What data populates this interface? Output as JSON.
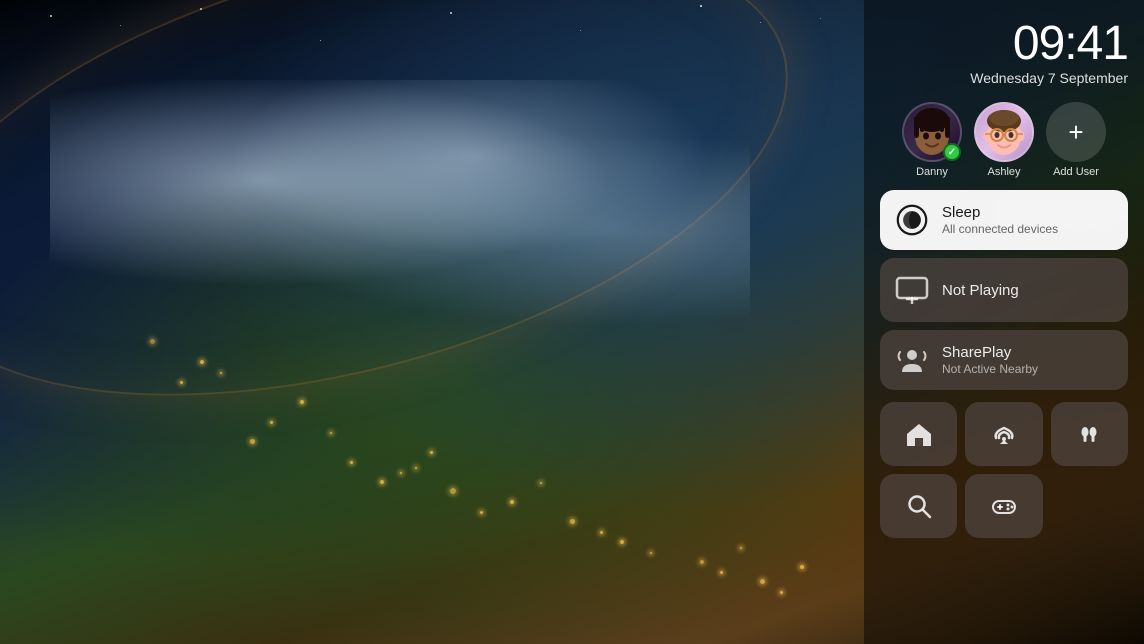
{
  "background": {
    "description": "Earth from space with city lights and clouds"
  },
  "header": {
    "time": "09:41",
    "date": "Wednesday 7 September"
  },
  "users": [
    {
      "name": "Danny",
      "active": true,
      "emoji": "🧑🏿"
    },
    {
      "name": "Ashley",
      "active": false,
      "emoji": "🧑"
    }
  ],
  "add_user": {
    "label": "Add User",
    "symbol": "+"
  },
  "sleep_card": {
    "title": "Sleep",
    "subtitle": "All connected devices"
  },
  "now_playing_card": {
    "title": "Not Playing"
  },
  "shareplay_card": {
    "title": "SharePlay",
    "subtitle": "Not Active Nearby"
  },
  "grid_buttons": [
    {
      "name": "home-icon",
      "label": "Home"
    },
    {
      "name": "airplay-icon",
      "label": "AirPlay"
    },
    {
      "name": "airpods-icon",
      "label": "AirPods"
    }
  ],
  "grid_buttons_bottom": [
    {
      "name": "search-icon",
      "label": "Search"
    },
    {
      "name": "gamecontroller-icon",
      "label": "Game Controller"
    }
  ],
  "colors": {
    "panel_bg": "rgba(0,0,0,0.45)",
    "card_white": "rgba(255,255,255,0.95)",
    "card_dark": "rgba(80,70,65,0.7)",
    "active_green": "#2ecc40"
  }
}
